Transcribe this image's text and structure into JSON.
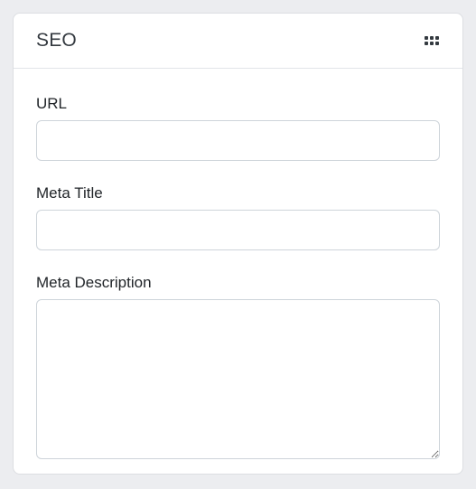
{
  "card": {
    "title": "SEO",
    "menu_icon": "grid-icon"
  },
  "fields": {
    "url": {
      "label": "URL",
      "value": "",
      "placeholder": ""
    },
    "meta_title": {
      "label": "Meta Title",
      "value": "",
      "placeholder": ""
    },
    "meta_description": {
      "label": "Meta Description",
      "value": "",
      "placeholder": ""
    }
  },
  "colors": {
    "page_background": "#ecedf0",
    "card_background": "#ffffff",
    "border": "#ced4da",
    "text": "#212529"
  }
}
